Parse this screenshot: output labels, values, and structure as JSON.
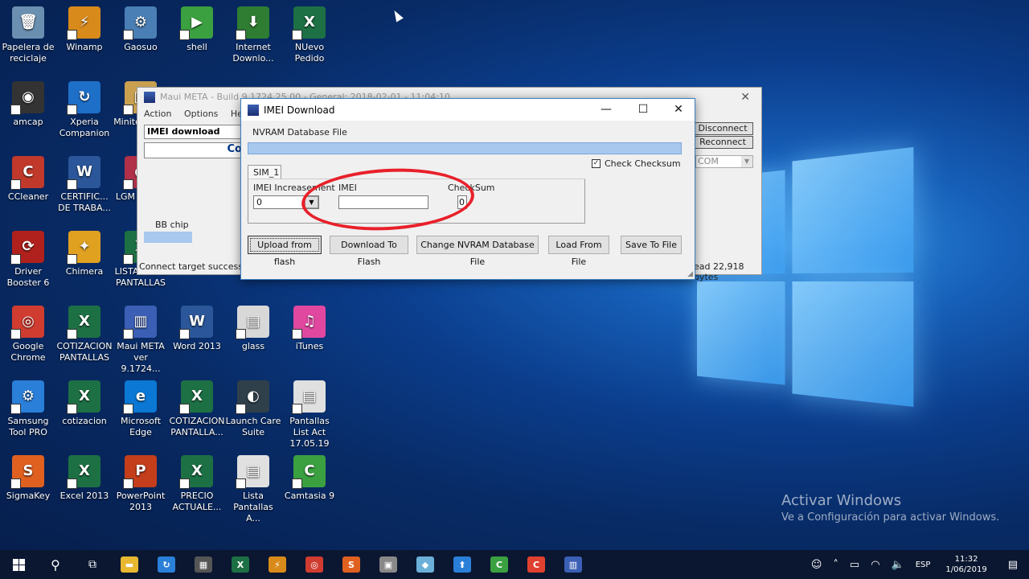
{
  "desktop": {
    "icons": [
      {
        "label": "Papelera de reciclaje",
        "color": "#6b8fb0",
        "glyph": "🗑"
      },
      {
        "label": "Winamp",
        "color": "#d88a1a",
        "glyph": "⚡"
      },
      {
        "label": "Gaosuo",
        "color": "#4a7fb5",
        "glyph": "⚙"
      },
      {
        "label": "shell",
        "color": "#3aa040",
        "glyph": "▶"
      },
      {
        "label": "Internet Downlo...",
        "color": "#2e7d32",
        "glyph": "⬇"
      },
      {
        "label": "NUevo Pedido",
        "color": "#1d7044",
        "glyph": "X"
      },
      {
        "label": "amcap",
        "color": "#333333",
        "glyph": "◉"
      },
      {
        "label": "Xperia Companion",
        "color": "#1e6fc8",
        "glyph": "↻"
      },
      {
        "label": "Minitool and F",
        "color": "#c8a050",
        "glyph": "▣"
      },
      {
        "label": "CCleaner",
        "color": "#c0392b",
        "glyph": "C"
      },
      {
        "label": "CERTIFIC... DE TRABA...",
        "color": "#2b579a",
        "glyph": "W"
      },
      {
        "label": "LGM Suppo",
        "color": "#b0304a",
        "glyph": "●"
      },
      {
        "label": "Driver Booster 6",
        "color": "#b0201c",
        "glyph": "⟳"
      },
      {
        "label": "Chimera",
        "color": "#e0a020",
        "glyph": "✦"
      },
      {
        "label": "LISTA FINAL PANTALLAS",
        "color": "#1d7044",
        "glyph": "X"
      },
      {
        "label": "Google Chrome",
        "color": "#d03c30",
        "glyph": "◎"
      },
      {
        "label": "COTIZACION PANTALLAS",
        "color": "#1d7044",
        "glyph": "X"
      },
      {
        "label": "Maui META ver 9.1724...",
        "color": "#3b5fb5",
        "glyph": "▥"
      },
      {
        "label": "Word 2013",
        "color": "#2b579a",
        "glyph": "W"
      },
      {
        "label": "glass",
        "color": "#d8d8d8",
        "glyph": "▤"
      },
      {
        "label": "iTunes",
        "color": "#e048a0",
        "glyph": "♫"
      },
      {
        "label": "Samsung Tool PRO",
        "color": "#2a7fd8",
        "glyph": "⚙"
      },
      {
        "label": "cotizacion",
        "color": "#1d7044",
        "glyph": "X"
      },
      {
        "label": "Microsoft Edge",
        "color": "#0a78d4",
        "glyph": "e"
      },
      {
        "label": "COTIZACION PANTALLA...",
        "color": "#1d7044",
        "glyph": "X"
      },
      {
        "label": "Launch Care Suite",
        "color": "#30404a",
        "glyph": "◐"
      },
      {
        "label": "Pantallas List Act 17.05.19",
        "color": "#e0e0e0",
        "glyph": "▤"
      },
      {
        "label": "SigmaKey",
        "color": "#e06020",
        "glyph": "S"
      },
      {
        "label": "Excel 2013",
        "color": "#1d7044",
        "glyph": "X"
      },
      {
        "label": "PowerPoint 2013",
        "color": "#c43e1c",
        "glyph": "P"
      },
      {
        "label": "PRECIO ACTUALE...",
        "color": "#1d7044",
        "glyph": "X"
      },
      {
        "label": "Lista Pantallas A...",
        "color": "#e0e0e0",
        "glyph": "▤"
      },
      {
        "label": "Camtasia 9",
        "color": "#3aa040",
        "glyph": "C"
      }
    ]
  },
  "back_window": {
    "title": "Maui META - Build 9.1724.25.00 - General: 2018-02-01 - 11:04:10",
    "menu": [
      "Action",
      "Options",
      "Help"
    ],
    "combo_value": "IMEI download",
    "text_partial": "Co",
    "bb_chip_label": "BB chip",
    "status_left": "Connect target successful",
    "btn_disconnect": "Disconnect",
    "btn_reconnect": "Reconnect",
    "com_value": "COM",
    "status_right": "ead 22,918 bytes"
  },
  "dialog": {
    "title": "IMEI Download",
    "nvram_label": "NVRAM Database File",
    "check_checksum_label": "Check Checksum",
    "check_checksum_checked": true,
    "tab_label": "SIM_1",
    "imei_increasement_label": "IMEI Increasement",
    "imei_increasement_value": "0",
    "imei_label": "IMEI",
    "imei_value": "",
    "checksum_label": "CheckSum",
    "checksum_value": "0",
    "buttons": {
      "upload": "Upload from flash",
      "download": "Download To Flash",
      "change": "Change NVRAM Database File",
      "load": "Load From File",
      "save": "Save To File"
    }
  },
  "activation": {
    "line1": "Activar Windows",
    "line2": "Ve a Configuración para activar Windows."
  },
  "taskbar": {
    "apps": [
      {
        "name": "file-explorer",
        "color": "#e8b830",
        "glyph": "▬"
      },
      {
        "name": "xperia",
        "color": "#2a7fd8",
        "glyph": "↻"
      },
      {
        "name": "calculator",
        "color": "#555555",
        "glyph": "▦"
      },
      {
        "name": "excel",
        "color": "#1d7044",
        "glyph": "X"
      },
      {
        "name": "winamp",
        "color": "#d88a1a",
        "glyph": "⚡"
      },
      {
        "name": "chrome",
        "color": "#d03c30",
        "glyph": "◎"
      },
      {
        "name": "sigmakey",
        "color": "#e06020",
        "glyph": "S"
      },
      {
        "name": "tool",
        "color": "#888888",
        "glyph": "▣"
      },
      {
        "name": "glass",
        "color": "#6ab0d8",
        "glyph": "◆"
      },
      {
        "name": "installer",
        "color": "#2a7fd8",
        "glyph": "⬆"
      },
      {
        "name": "camtasia",
        "color": "#3aa040",
        "glyph": "C"
      },
      {
        "name": "camtasia-rec",
        "color": "#e04030",
        "glyph": "C"
      },
      {
        "name": "maui-meta",
        "color": "#3b5fb5",
        "glyph": "▥"
      }
    ],
    "language": "ESP",
    "time": "11:32",
    "date": "1/06/2019"
  }
}
